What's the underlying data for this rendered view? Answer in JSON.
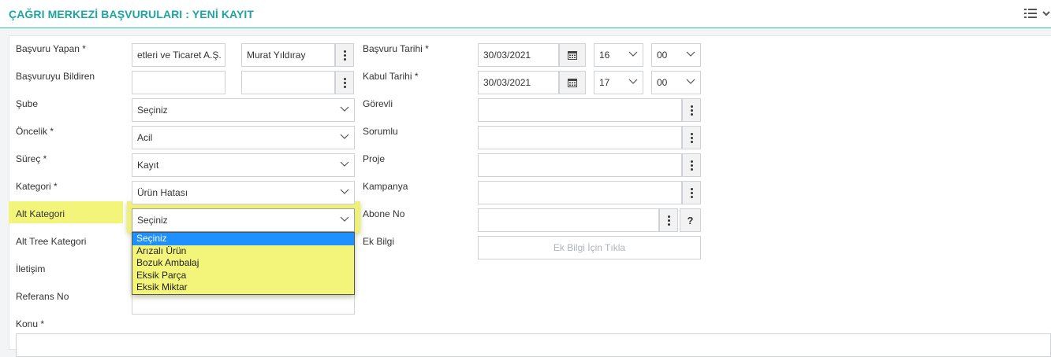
{
  "header": {
    "title": "ÇAĞRI MERKEZİ BAŞVURULARI : YENİ KAYIT"
  },
  "left": {
    "basvuru_yapan": {
      "label": "Başvuru Yapan *",
      "company": "etleri ve Ticaret A.Ş.",
      "person": "Murat Yıldıray"
    },
    "basvuruyu_bildiren": {
      "label": "Başvuruyu Bildiren",
      "company": "",
      "person": ""
    },
    "sube": {
      "label": "Şube",
      "value": "Seçiniz"
    },
    "oncelik": {
      "label": "Öncelik *",
      "value": "Acil"
    },
    "surec": {
      "label": "Süreç *",
      "value": "Kayıt"
    },
    "kategori": {
      "label": "Kategori *",
      "value": "Ürün Hatası"
    },
    "alt_kategori": {
      "label": "Alt Kategori",
      "value": "Seçiniz",
      "options": [
        "Seçiniz",
        "Arızalı Ürün",
        "Bozuk Ambalaj",
        "Eksik Parça",
        "Eksik Miktar"
      ]
    },
    "alt_tree_kategori": {
      "label": "Alt Tree Kategori"
    },
    "iletisim": {
      "label": "İletişim"
    },
    "referans_no": {
      "label": "Referans No"
    },
    "konu": {
      "label": "Konu *"
    }
  },
  "right": {
    "basvuru_tarihi": {
      "label": "Başvuru Tarihi *",
      "date": "30/03/2021",
      "hour": "16",
      "minute": "00"
    },
    "kabul_tarihi": {
      "label": "Kabul Tarihi *",
      "date": "30/03/2021",
      "hour": "17",
      "minute": "00"
    },
    "gorevli": {
      "label": "Görevli"
    },
    "sorumlu": {
      "label": "Sorumlu"
    },
    "proje": {
      "label": "Proje"
    },
    "kampanya": {
      "label": "Kampanya"
    },
    "abone_no": {
      "label": "Abone No",
      "help": "?"
    },
    "ek_bilgi": {
      "label": "Ek Bilgi",
      "button": "Ek Bilgi İçin Tıkla"
    }
  },
  "colors": {
    "accent": "#1fa5a1",
    "highlight": "#f2f57a",
    "selected_option": "#1e90ff"
  }
}
